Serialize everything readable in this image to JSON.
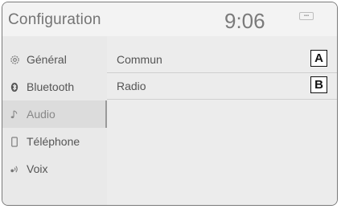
{
  "header": {
    "title": "Configuration",
    "clock": "9:06",
    "status_icon": "signal-status-icon"
  },
  "sidebar": {
    "items": [
      {
        "label": "Général",
        "icon": "gear-icon"
      },
      {
        "label": "Bluetooth",
        "icon": "bluetooth-icon"
      },
      {
        "label": "Audio",
        "icon": "music-note-icon",
        "active": true
      },
      {
        "label": "Téléphone",
        "icon": "phone-icon"
      },
      {
        "label": "Voix",
        "icon": "voice-icon"
      }
    ],
    "more_icon": "chevron-down-icon"
  },
  "main": {
    "rows": [
      {
        "label": "Commun",
        "marker": "A"
      },
      {
        "label": "Radio",
        "marker": "B"
      }
    ]
  },
  "colors": {
    "background": "#ececec",
    "text": "#555555",
    "active_item": "#dcdcdc"
  }
}
